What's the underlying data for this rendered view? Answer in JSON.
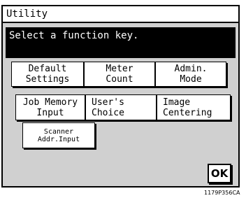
{
  "screen": {
    "title": "Utility",
    "message": "Select a function key.",
    "ok_label": "OK"
  },
  "function_keys": [
    {
      "label": "Default\nSettings"
    },
    {
      "label": "Meter\nCount"
    },
    {
      "label": "Admin.\nMode"
    },
    {
      "label": "Job Memory\nInput"
    },
    {
      "label": "User's\nChoice"
    },
    {
      "label": "Image\nCentering"
    },
    {
      "label": "Scanner\nAddr.Input"
    }
  ],
  "figure_code": "1179P356CA"
}
